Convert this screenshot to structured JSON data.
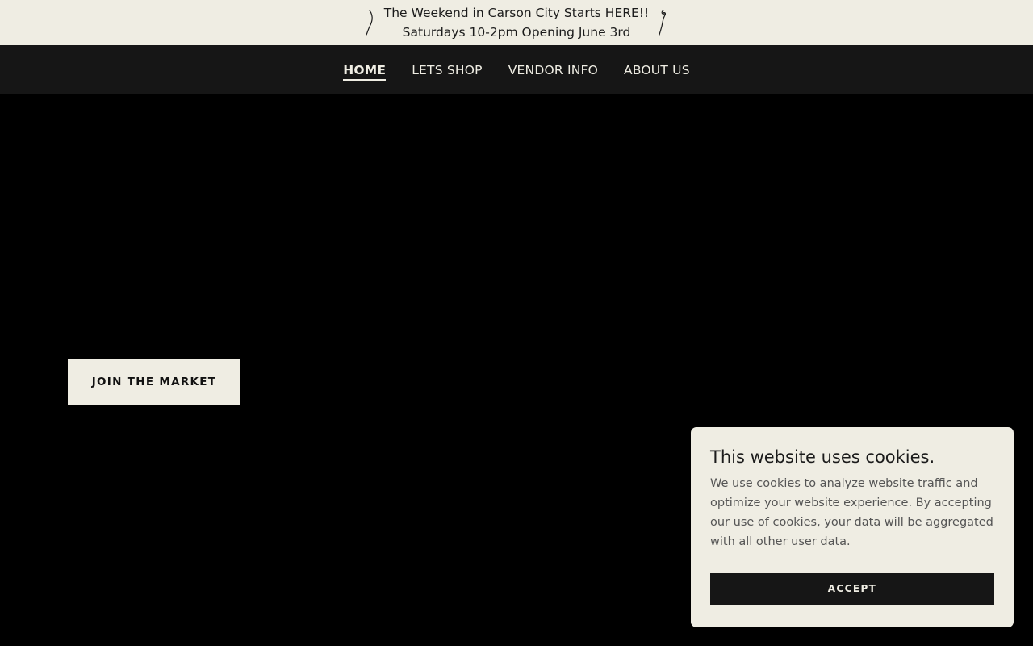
{
  "announcement": {
    "line1": "The Weekend in Carson City Starts HERE!!",
    "line2": "Saturdays 10-2pm Opening June 3rd",
    "left_icon": "squiggle-left-icon",
    "right_icon": "squiggle-right-icon"
  },
  "nav": {
    "items": [
      {
        "label": "HOME",
        "active": true
      },
      {
        "label": "LETS SHOP",
        "active": false
      },
      {
        "label": "VENDOR INFO",
        "active": false
      },
      {
        "label": "ABOUT US",
        "active": false
      }
    ]
  },
  "hero": {
    "cta_label": "JOIN THE MARKET"
  },
  "cookie_banner": {
    "title": "This website uses cookies.",
    "body": "We use cookies to analyze website traffic and optimize your website experience. By accepting our use of cookies, your data will be aggregated with all other user data.",
    "accept_label": "ACCEPT"
  },
  "colors": {
    "announcement_bg": "#efede3",
    "nav_bg": "#161616",
    "hero_bg": "#000000",
    "cream": "#efede3",
    "dark_button": "#161616"
  }
}
